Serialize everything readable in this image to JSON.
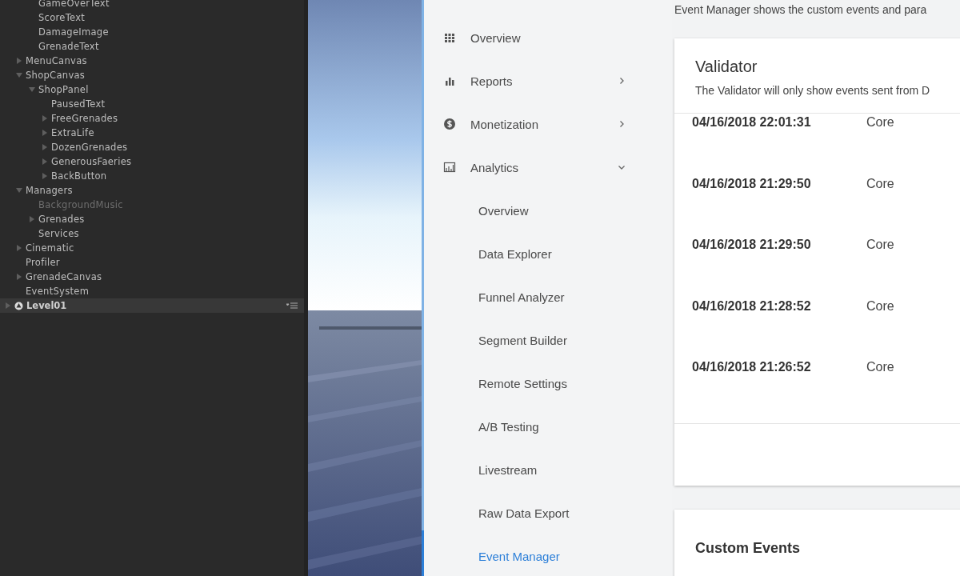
{
  "hierarchy": {
    "continued_children": [
      {
        "name": "GameOverText",
        "active": true
      },
      {
        "name": "ScoreText",
        "active": true
      },
      {
        "name": "DamageImage",
        "active": true
      },
      {
        "name": "GrenadeText",
        "active": true
      }
    ],
    "items": [
      {
        "name": "MenuCanvas",
        "expanded": false,
        "active": true
      },
      {
        "name": "ShopCanvas",
        "expanded": true,
        "active": true,
        "children": [
          {
            "name": "ShopPanel",
            "expanded": true,
            "active": true,
            "children": [
              {
                "name": "PausedText",
                "active": true
              },
              {
                "name": "FreeGrenades",
                "expanded": false,
                "active": true
              },
              {
                "name": "ExtraLife",
                "expanded": false,
                "active": true
              },
              {
                "name": "DozenGrenades",
                "expanded": false,
                "active": true
              },
              {
                "name": "GenerousFaeries",
                "expanded": false,
                "active": true
              },
              {
                "name": "BackButton",
                "expanded": false,
                "active": true
              }
            ]
          }
        ]
      },
      {
        "name": "Managers",
        "expanded": true,
        "active": true,
        "children": [
          {
            "name": "BackgroundMusic",
            "active": false
          },
          {
            "name": "Grenades",
            "expanded": false,
            "active": true
          },
          {
            "name": "Services",
            "active": true
          }
        ]
      },
      {
        "name": "Cinematic",
        "expanded": false,
        "active": true
      },
      {
        "name": "Profiler",
        "active": true
      },
      {
        "name": "GrenadeCanvas",
        "expanded": false,
        "active": true
      },
      {
        "name": "EventSystem",
        "active": true
      }
    ],
    "scene": {
      "name": "Level01",
      "expanded": false
    }
  },
  "nav": {
    "items": [
      {
        "label": "Overview",
        "kind": "section",
        "selected": false
      },
      {
        "label": "Reports",
        "kind": "section",
        "expanded": false,
        "selected": false
      },
      {
        "label": "Monetization",
        "kind": "section",
        "expanded": false,
        "selected": false
      },
      {
        "label": "Analytics",
        "kind": "section",
        "expanded": true,
        "selected": false
      },
      {
        "label": "Overview",
        "kind": "subitem",
        "selected": false
      },
      {
        "label": "Data Explorer",
        "kind": "subitem",
        "selected": false
      },
      {
        "label": "Funnel Analyzer",
        "kind": "subitem",
        "selected": false
      },
      {
        "label": "Segment Builder",
        "kind": "subitem",
        "selected": false
      },
      {
        "label": "Remote Settings",
        "kind": "subitem",
        "selected": false
      },
      {
        "label": "A/B Testing",
        "kind": "subitem",
        "selected": false
      },
      {
        "label": "Livestream",
        "kind": "subitem",
        "selected": false
      },
      {
        "label": "Raw Data Export",
        "kind": "subitem",
        "selected": false
      },
      {
        "label": "Event Manager",
        "kind": "subitem",
        "selected": true
      }
    ]
  },
  "main": {
    "intro": "Event Manager shows the custom events and para",
    "validator": {
      "title": "Validator",
      "description": "The Validator will only show events sent from D",
      "events": [
        {
          "time": "04/16/2018 22:01:31",
          "type": "Core"
        },
        {
          "time": "04/16/2018 21:29:50",
          "type": "Core"
        },
        {
          "time": "04/16/2018 21:29:50",
          "type": "Core"
        },
        {
          "time": "04/16/2018 21:28:52",
          "type": "Core"
        },
        {
          "time": "04/16/2018 21:26:52",
          "type": "Core"
        }
      ]
    },
    "custom_events": {
      "title": "Custom Events"
    }
  }
}
